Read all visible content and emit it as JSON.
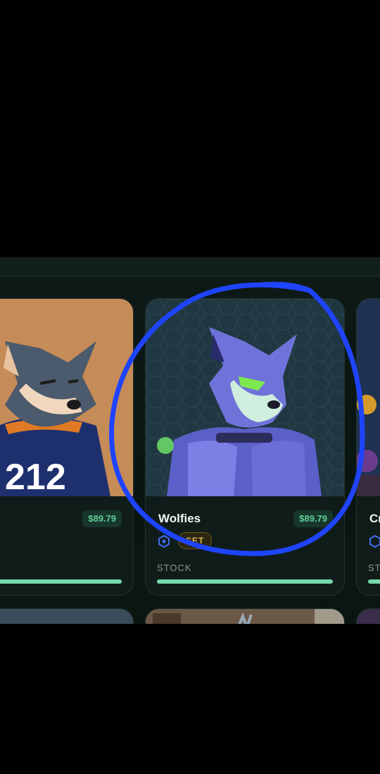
{
  "cards": [
    {
      "name": "",
      "price": "$89.79",
      "tag": "",
      "stock_label": ""
    },
    {
      "name": "Wolfies",
      "price": "$89.79",
      "tag": "SET",
      "stock_label": "STOCK"
    },
    {
      "name": "Cr",
      "price": "",
      "tag": "",
      "stock_label": "ST"
    }
  ],
  "jersey_number": "212",
  "colors": {
    "accent_green": "#5fcf98",
    "progress": "#76d9ad",
    "annotation_blue": "#1f44ff",
    "tag_gold": "#d7b54b"
  }
}
